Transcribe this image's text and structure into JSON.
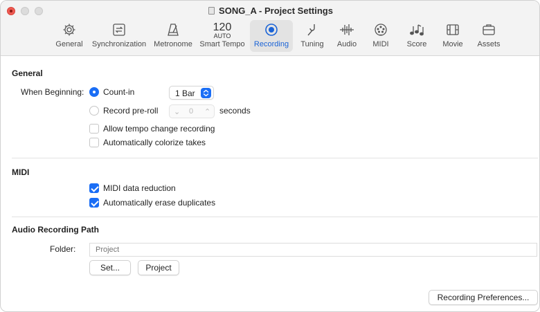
{
  "window": {
    "title": "SONG_A - Project Settings"
  },
  "toolbar": {
    "tabs": [
      {
        "id": "general",
        "label": "General",
        "icon": "gear-icon"
      },
      {
        "id": "synchronization",
        "label": "Synchronization",
        "icon": "sync-icon"
      },
      {
        "id": "metronome",
        "label": "Metronome",
        "icon": "metronome-icon"
      },
      {
        "id": "smart-tempo",
        "label": "Smart Tempo",
        "tempo_value": "120",
        "tempo_mode": "AUTO"
      },
      {
        "id": "recording",
        "label": "Recording",
        "icon": "record-icon",
        "active": true
      },
      {
        "id": "tuning",
        "label": "Tuning",
        "icon": "tuning-fork-icon"
      },
      {
        "id": "audio",
        "label": "Audio",
        "icon": "waveform-icon"
      },
      {
        "id": "midi",
        "label": "MIDI",
        "icon": "midi-port-icon"
      },
      {
        "id": "score",
        "label": "Score",
        "icon": "music-notes-icon"
      },
      {
        "id": "movie",
        "label": "Movie",
        "icon": "film-icon"
      },
      {
        "id": "assets",
        "label": "Assets",
        "icon": "briefcase-icon"
      }
    ]
  },
  "general": {
    "title": "General",
    "when_beginning_label": "When Beginning:",
    "count_in": {
      "label": "Count-in",
      "selected": true,
      "bars_value": "1 Bar"
    },
    "record_preroll": {
      "label": "Record pre-roll",
      "selected": false,
      "value": "0",
      "unit": "seconds"
    },
    "allow_tempo_change": {
      "label": "Allow tempo change recording",
      "checked": false
    },
    "auto_colorize": {
      "label": "Automatically colorize takes",
      "checked": false
    }
  },
  "midi": {
    "title": "MIDI",
    "data_reduction": {
      "label": "MIDI data reduction",
      "checked": true
    },
    "erase_duplicates": {
      "label": "Automatically erase duplicates",
      "checked": true
    }
  },
  "audio_path": {
    "title": "Audio Recording Path",
    "folder_label": "Folder:",
    "folder_placeholder": "Project",
    "set_button": "Set...",
    "project_button": "Project"
  },
  "footer": {
    "recording_prefs_button": "Recording Preferences..."
  },
  "colors": {
    "accent": "#1b6ef5",
    "close": "#ee5a52"
  }
}
